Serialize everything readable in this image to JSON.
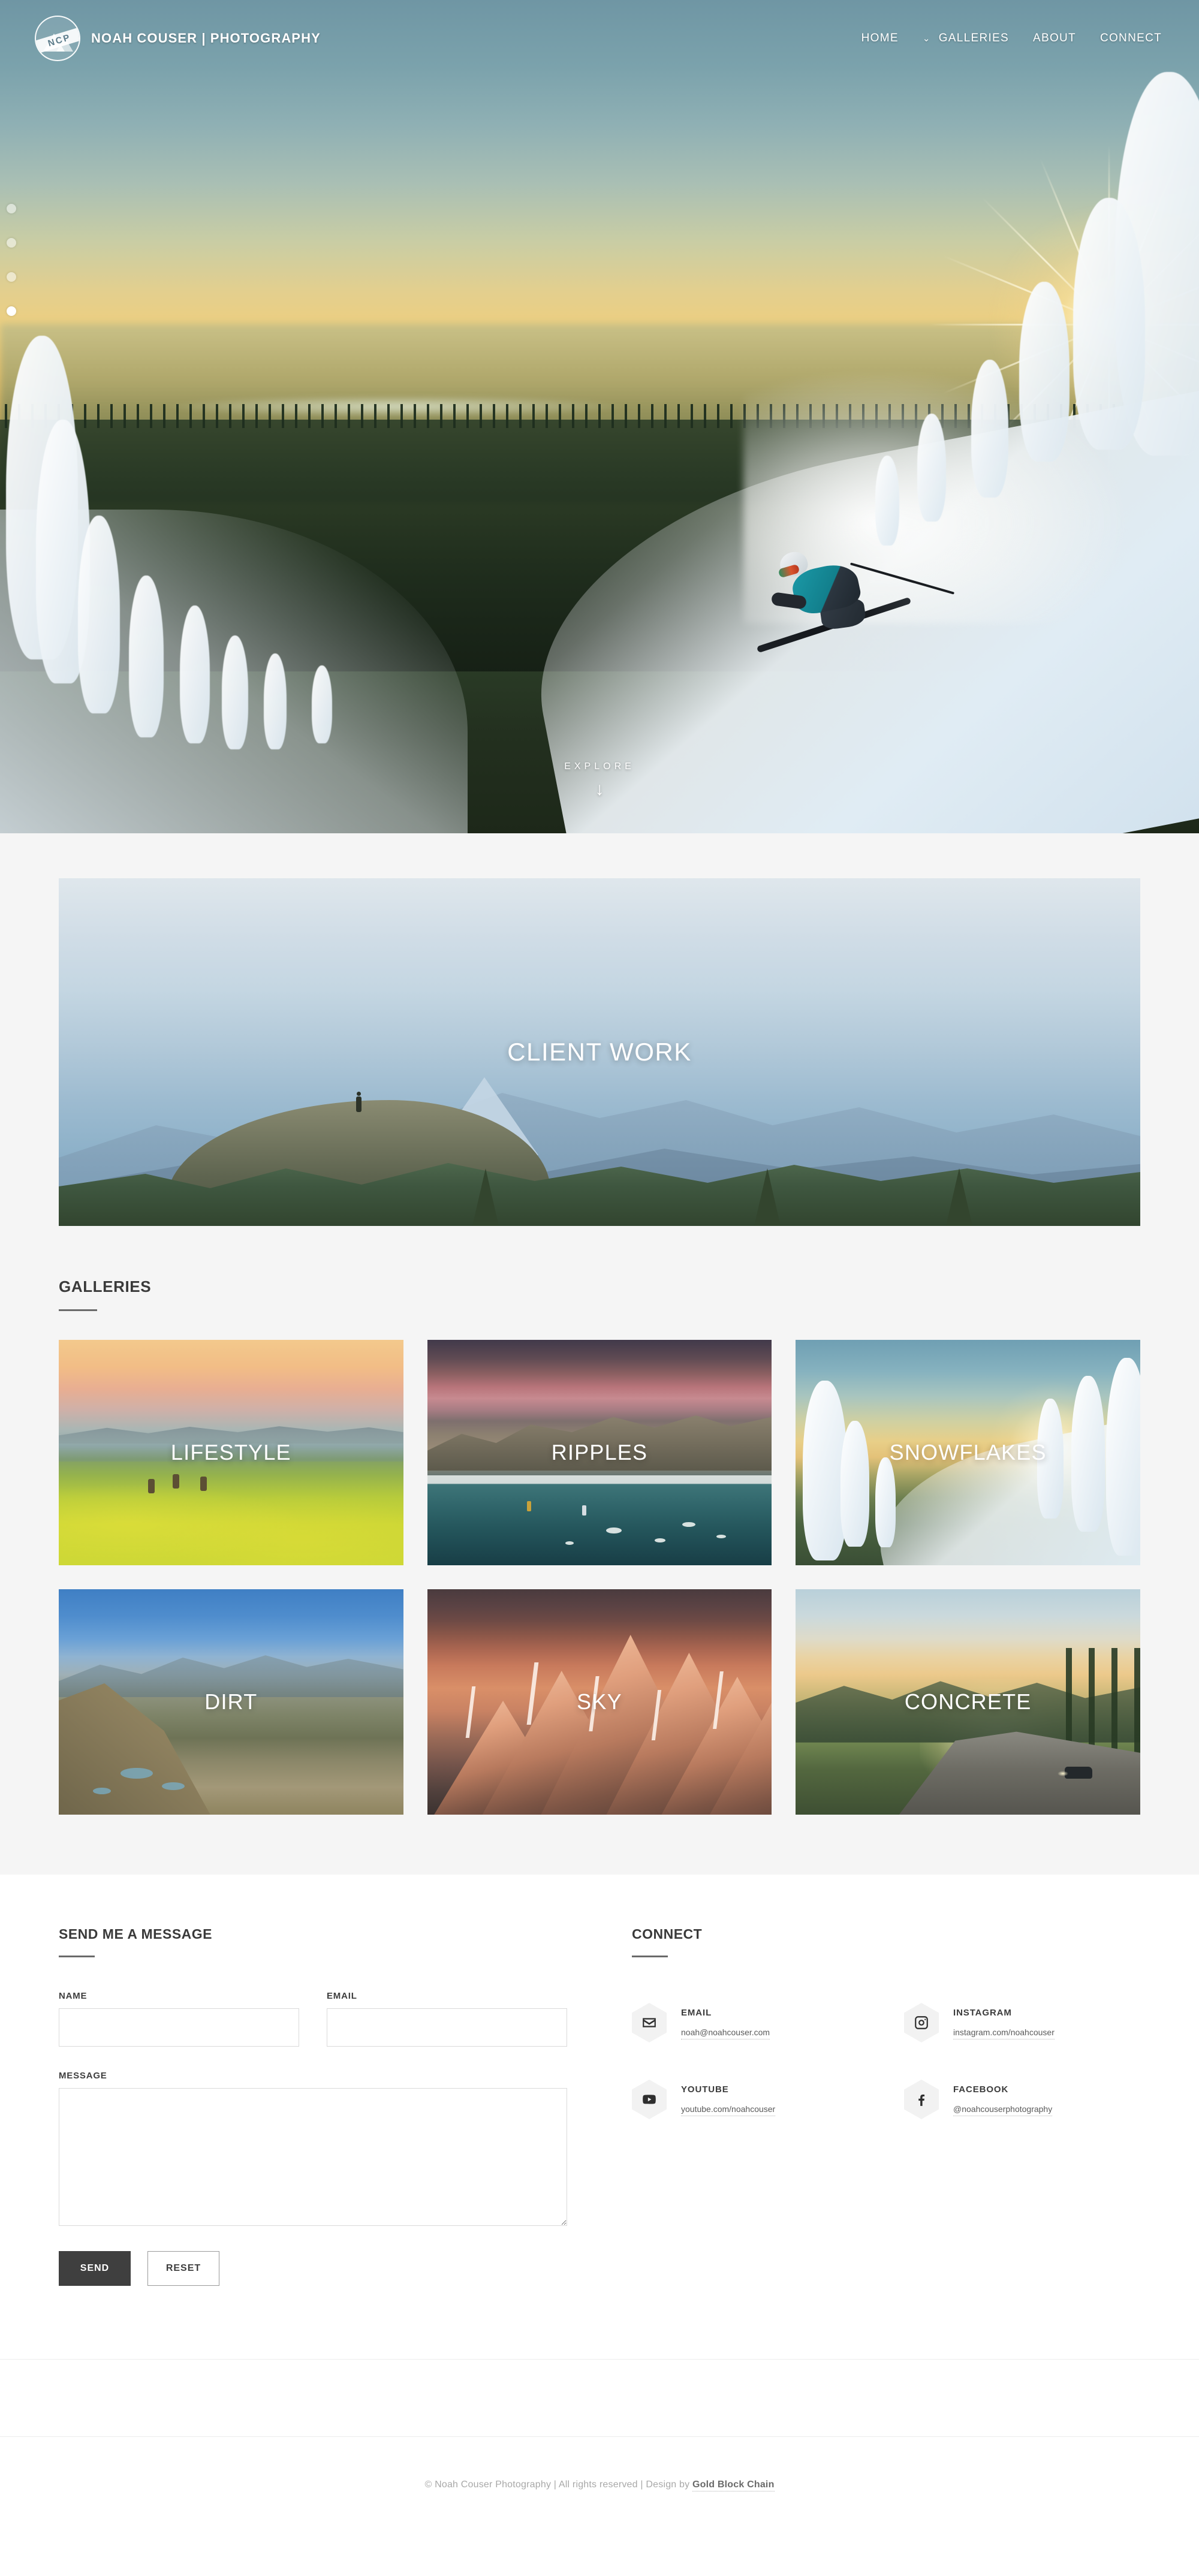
{
  "header": {
    "brand_name": "NOAH COUSER | PHOTOGRAPHY",
    "logo_text": "NCP",
    "nav": [
      {
        "label": "HOME",
        "has_chevron": false
      },
      {
        "label": "GALLERIES",
        "has_chevron": true,
        "chevron": "⌄"
      },
      {
        "label": "ABOUT",
        "has_chevron": false
      },
      {
        "label": "CONNECT",
        "has_chevron": false
      }
    ]
  },
  "hero": {
    "explore_label": "EXPLORE",
    "explore_arrow": "↓",
    "slides": [
      {
        "active": false
      },
      {
        "active": false
      },
      {
        "active": false
      },
      {
        "active": true
      }
    ]
  },
  "client_work": {
    "title": "CLIENT WORK"
  },
  "galleries": {
    "heading": "GALLERIES",
    "tiles": [
      {
        "label": "LIFESTYLE",
        "theme": "lifestyle"
      },
      {
        "label": "RIPPLES",
        "theme": "ripples"
      },
      {
        "label": "SNOWFLAKES",
        "theme": "snow"
      },
      {
        "label": "DIRT",
        "theme": "dirt"
      },
      {
        "label": "SKY",
        "theme": "sky"
      },
      {
        "label": "CONCRETE",
        "theme": "concrete"
      }
    ]
  },
  "contact": {
    "heading": "SEND ME A MESSAGE",
    "name_label": "NAME",
    "name_value": "",
    "name_placeholder": "",
    "email_label": "EMAIL",
    "email_value": "",
    "email_placeholder": "",
    "message_label": "MESSAGE",
    "message_value": "",
    "message_placeholder": "",
    "send_label": "SEND",
    "reset_label": "RESET"
  },
  "connect": {
    "heading": "CONNECT",
    "items": [
      {
        "label": "EMAIL",
        "value": "noah@noahcouser.com",
        "icon": "envelope-icon"
      },
      {
        "label": "INSTAGRAM",
        "value": "instagram.com/noahcouser",
        "icon": "instagram-icon"
      },
      {
        "label": "YOUTUBE",
        "value": "youtube.com/noahcouser",
        "icon": "youtube-icon"
      },
      {
        "label": "FACEBOOK",
        "value": "@noahcouserphotography",
        "icon": "facebook-icon"
      }
    ]
  },
  "footer": {
    "text_prefix": "© Noah Couser Photography | All rights reserved | Design by ",
    "designer_link": "Gold Block Chain"
  },
  "colors": {
    "page_bg": "#ffffff",
    "section_bg": "#f5f5f5",
    "heading": "#3a3a3a",
    "rule": "#6a6a6a",
    "send_button_bg": "#3f3f3f",
    "input_border": "#dadada",
    "footer_text": "#a8a8a8"
  }
}
